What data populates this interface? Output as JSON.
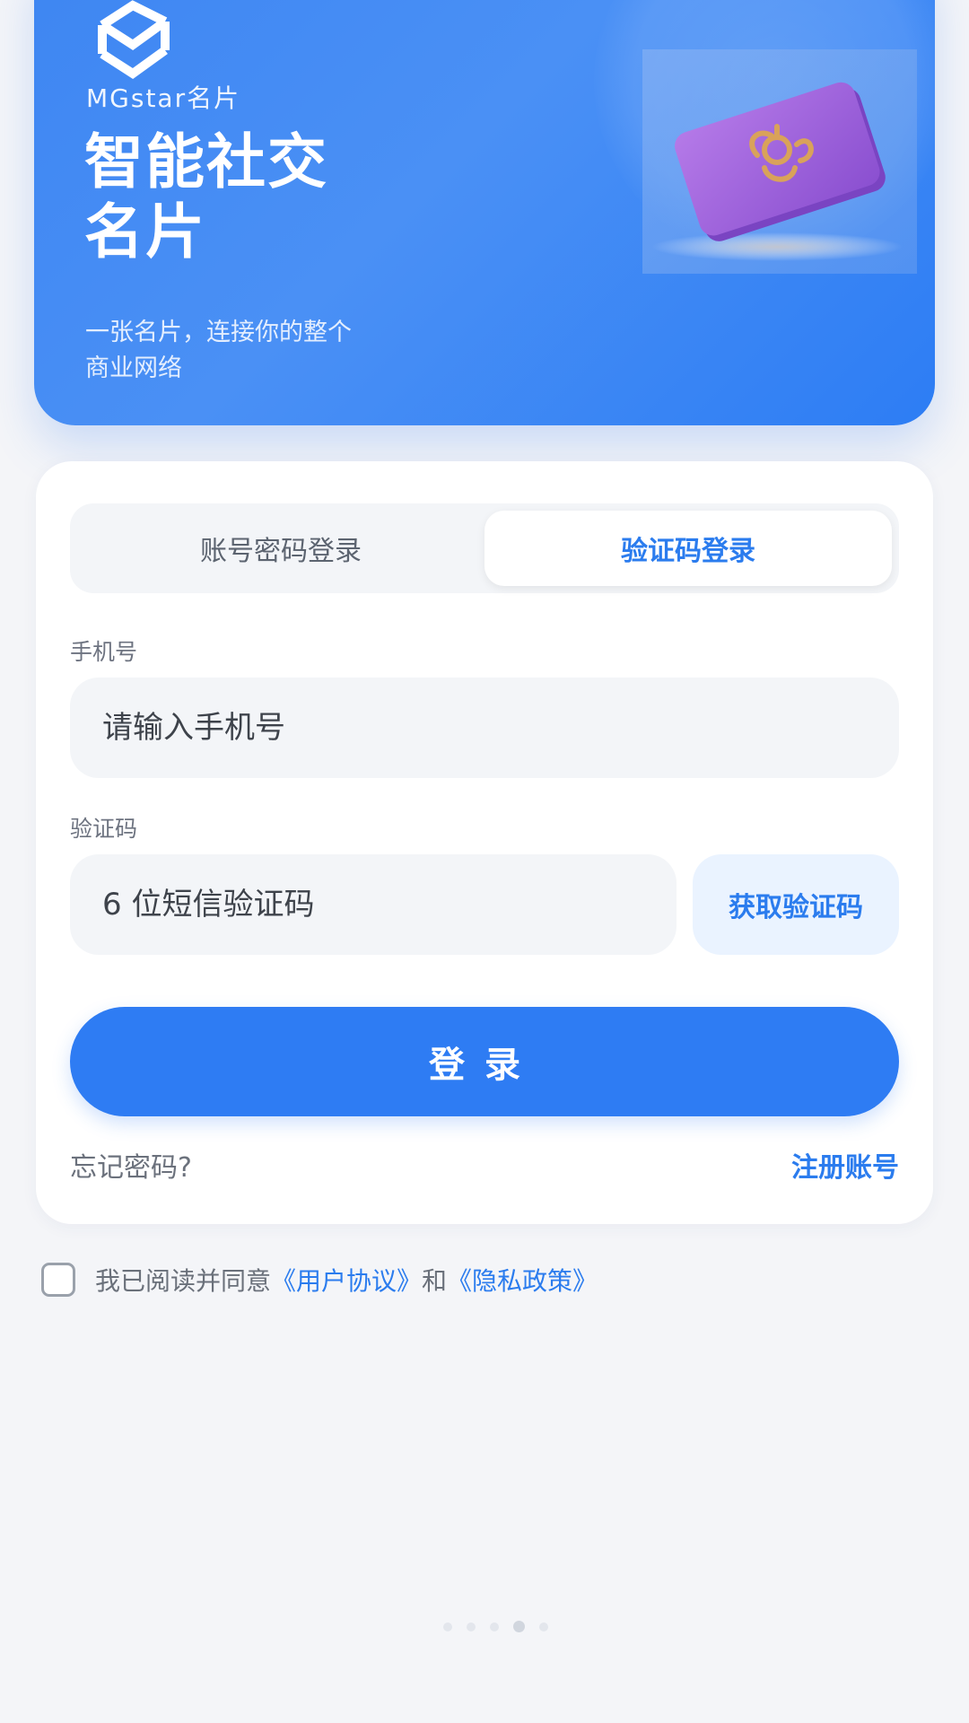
{
  "hero": {
    "brand": "MGstar名片",
    "headline": "智能社交名片",
    "subline": "一张名片，连接你的整个商业网络",
    "colors": {
      "primary": "#3e86f2",
      "card": "#9b5fd6",
      "emblem": "#d9a25a"
    }
  },
  "login": {
    "tabs": [
      {
        "label": "账号密码登录",
        "selected": false
      },
      {
        "label": "验证码登录",
        "selected": true
      }
    ],
    "phone": {
      "label": "手机号",
      "placeholder": "请输入手机号",
      "value": ""
    },
    "code": {
      "label": "验证码",
      "placeholder": "6 位短信验证码",
      "value": ""
    },
    "get_code_label": "获取验证码",
    "submit_label": "登录",
    "forgot_label": "忘记密码?",
    "register_label": "注册账号"
  },
  "agreement": {
    "checked": false,
    "prefix": "我已阅读并同意",
    "user_agreement": "《用户协议》",
    "and": "和",
    "privacy_policy": "《隐私政策》"
  },
  "pager": {
    "count": 5,
    "active_index": 3
  },
  "icons": {
    "logo": "mgstar-logo-icon",
    "card_art": "business-card-illustration-icon"
  }
}
